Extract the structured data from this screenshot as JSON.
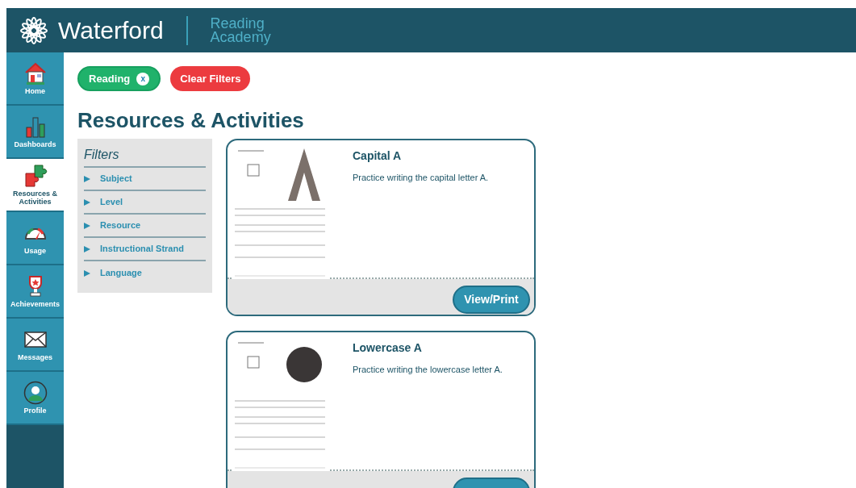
{
  "header": {
    "brand": "Waterford",
    "product_line1": "Reading",
    "product_line2": "Academy"
  },
  "sidebar": {
    "items": [
      {
        "label": "Home",
        "selected": false
      },
      {
        "label": "Dashboards",
        "selected": false
      },
      {
        "label": "Resources & Activities",
        "selected": true
      },
      {
        "label": "Usage",
        "selected": false
      },
      {
        "label": "Achievements",
        "selected": false
      },
      {
        "label": "Messages",
        "selected": false
      },
      {
        "label": "Profile",
        "selected": false
      }
    ]
  },
  "active_filters": [
    {
      "label": "Reading",
      "remove": "x"
    }
  ],
  "clear_button": "Clear Filters",
  "title": "Resources & Activities",
  "filters": {
    "heading": "Filters",
    "items": [
      {
        "label": "Subject",
        "expanded": false
      },
      {
        "label": "Level",
        "expanded": false
      },
      {
        "label": "Resource",
        "expanded": false
      },
      {
        "label": "Instructional Strand",
        "expanded": false
      },
      {
        "label": "Language",
        "expanded": false
      }
    ]
  },
  "cards": [
    {
      "title": "Capital A",
      "description": "Practice writing the capital letter A.",
      "button": "View/Print"
    },
    {
      "title": "Lowercase A",
      "description": "Practice writing the lowercase letter A."
    }
  ]
}
